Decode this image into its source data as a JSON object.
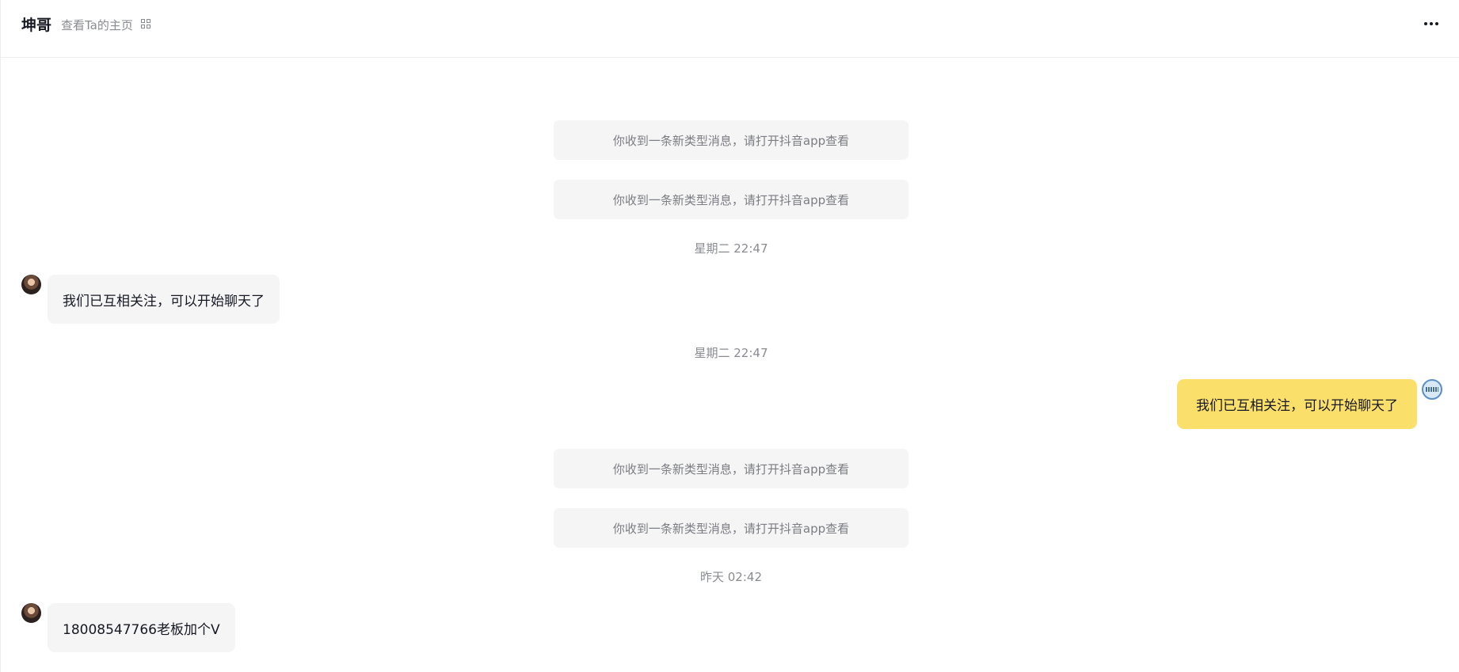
{
  "header": {
    "contact_name": "坤哥",
    "profile_link": "查看Ta的主页",
    "qr_icon": "qr-code-icon",
    "more_icon": "ellipsis-icon"
  },
  "messages": {
    "system_notice": "你收到一条新类型消息，请打开抖音app查看",
    "time_1": "星期二 22:47",
    "in_1": "我们已互相关注，可以开始聊天了",
    "time_2": "星期二 22:47",
    "out_1": "我们已互相关注，可以开始聊天了",
    "time_3": "昨天 02:42",
    "in_2": "18008547766老板加个V"
  },
  "colors": {
    "outgoing_bubble": "#fadf6a",
    "incoming_bubble": "#f5f5f5",
    "system_bubble": "#f5f5f5"
  }
}
